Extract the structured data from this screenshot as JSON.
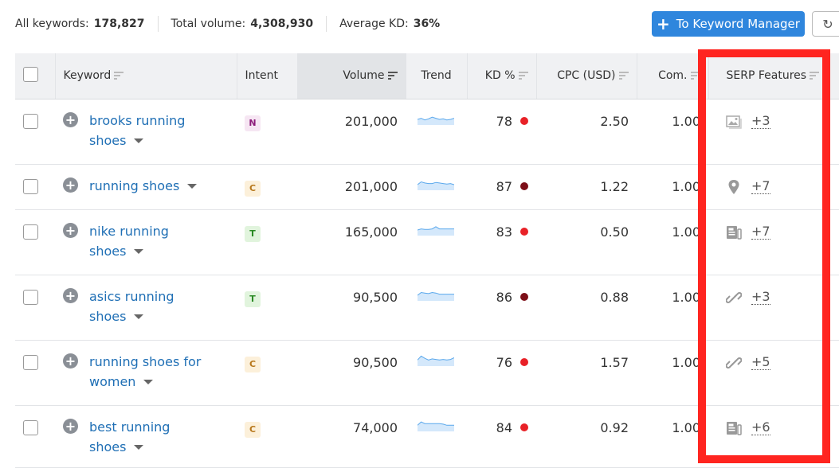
{
  "summary": {
    "all_keywords_label": "All keywords:",
    "all_keywords_value": "178,827",
    "total_volume_label": "Total volume:",
    "total_volume_value": "4,308,930",
    "avg_kd_label": "Average KD:",
    "avg_kd_value": "36%"
  },
  "toolbar": {
    "keyword_manager_label": "To Keyword Manager",
    "refresh_icon": "refresh-icon"
  },
  "columns": [
    "Keyword",
    "Intent",
    "Volume",
    "Trend",
    "KD %",
    "CPC (USD)",
    "Com.",
    "SERP Features"
  ],
  "colors": {
    "accent": "#2f86dd",
    "link": "#1f6fb5",
    "highlight": "#ff2520",
    "kd_hard": "#e82127",
    "kd_very_hard": "#7c0e17",
    "intent_N_bg": "#f6e6f3",
    "intent_N_fg": "#8c1b7a",
    "intent_C_bg": "#fcf0da",
    "intent_C_fg": "#b7771b",
    "intent_T_bg": "#e1f4dd",
    "intent_T_fg": "#2a8a24"
  },
  "rows": [
    {
      "kw1": "brooks running",
      "kw2": "shoes",
      "intent": "N",
      "volume": "201,000",
      "kd": "78",
      "kd_level": "hard",
      "cpc": "2.50",
      "com": "1.00",
      "serp_icon": "image-icon",
      "serp_more": "+3",
      "trend": [
        0.5,
        0.6,
        0.45,
        0.55,
        0.7,
        0.6,
        0.5,
        0.55,
        0.45,
        0.5,
        0.6
      ]
    },
    {
      "kw1": "running shoes",
      "kw2": "",
      "intent": "C",
      "volume": "201,000",
      "kd": "87",
      "kd_level": "very_hard",
      "cpc": "1.22",
      "com": "1.00",
      "serp_icon": "location-pin-icon",
      "serp_more": "+7",
      "trend": [
        0.5,
        0.75,
        0.65,
        0.6,
        0.6,
        0.7,
        0.65,
        0.6,
        0.55,
        0.6,
        0.5
      ]
    },
    {
      "kw1": "nike running",
      "kw2": "shoes",
      "intent": "T",
      "volume": "165,000",
      "kd": "83",
      "kd_level": "hard",
      "cpc": "0.50",
      "com": "1.00",
      "serp_icon": "news-icon",
      "serp_more": "+7",
      "trend": [
        0.5,
        0.6,
        0.55,
        0.55,
        0.6,
        0.8,
        0.6,
        0.6,
        0.6,
        0.6,
        0.6
      ]
    },
    {
      "kw1": "asics running",
      "kw2": "shoes",
      "intent": "T",
      "volume": "90,500",
      "kd": "86",
      "kd_level": "very_hard",
      "cpc": "0.88",
      "com": "1.00",
      "serp_icon": "link-icon",
      "serp_more": "+3",
      "trend": [
        0.5,
        0.75,
        0.7,
        0.65,
        0.75,
        0.7,
        0.6,
        0.6,
        0.6,
        0.6,
        0.6
      ]
    },
    {
      "kw1": "running shoes for",
      "kw2": "women",
      "intent": "C",
      "volume": "90,500",
      "kd": "76",
      "kd_level": "hard",
      "cpc": "1.57",
      "com": "1.00",
      "serp_icon": "link-icon",
      "serp_more": "+5",
      "trend": [
        0.55,
        0.9,
        0.7,
        0.55,
        0.65,
        0.6,
        0.55,
        0.6,
        0.55,
        0.6,
        0.75
      ]
    },
    {
      "kw1": "best running",
      "kw2": "shoes",
      "intent": "C",
      "volume": "74,000",
      "kd": "84",
      "kd_level": "hard",
      "cpc": "0.92",
      "com": "1.00",
      "serp_icon": "news-icon",
      "serp_more": "+6",
      "trend": [
        0.55,
        0.85,
        0.7,
        0.7,
        0.7,
        0.7,
        0.7,
        0.65,
        0.55,
        0.55,
        0.55
      ]
    }
  ]
}
